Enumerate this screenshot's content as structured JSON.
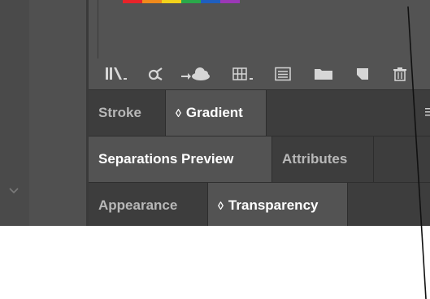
{
  "colors": {
    "panel": "#535353",
    "tab_bar": "#3d3d3d",
    "swatches": [
      "#e8232a",
      "#f08a1c",
      "#f2d21b",
      "#2aa84a",
      "#1f5fbf",
      "#9b38b6"
    ]
  },
  "toolbar": {
    "icons": [
      "library-icon",
      "link-icon",
      "cloud-icon",
      "swatch-grid-icon",
      "list-icon",
      "folder-icon",
      "new-swatch-icon",
      "trash-icon"
    ]
  },
  "panels": {
    "row1": {
      "tabs": [
        "Stroke",
        "Gradient"
      ],
      "active": 1
    },
    "row2": {
      "tabs": [
        "Separations Preview",
        "Attributes"
      ],
      "active": 0
    },
    "row3": {
      "tabs": [
        "Appearance",
        "Transparency"
      ],
      "active": 1
    }
  },
  "glyphs": {
    "updown": "◊"
  }
}
